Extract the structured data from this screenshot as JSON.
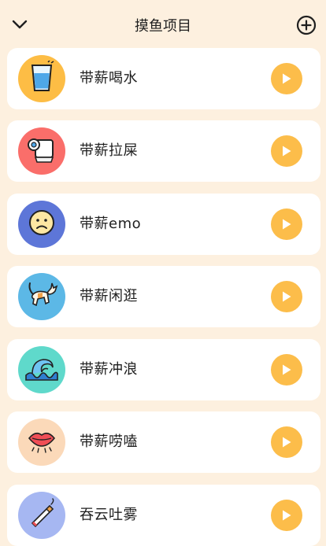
{
  "header": {
    "title": "摸鱼项目"
  },
  "items": [
    {
      "label": "带薪喝水",
      "icon": "water-glass-icon",
      "color": "#fdbd45"
    },
    {
      "label": "带薪拉屎",
      "icon": "toilet-paper-icon",
      "color": "#fa6e6a"
    },
    {
      "label": "带薪emo",
      "icon": "sad-face-icon",
      "color": "#5d76d8"
    },
    {
      "label": "带薪闲逛",
      "icon": "cat-icon",
      "color": "#5cb8e6"
    },
    {
      "label": "带薪冲浪",
      "icon": "wave-icon",
      "color": "#5fd9cb"
    },
    {
      "label": "带薪唠嗑",
      "icon": "lips-icon",
      "color": "#fbd9b9"
    },
    {
      "label": "吞云吐雾",
      "icon": "cigarette-icon",
      "color": "#a6b7f2"
    }
  ],
  "colors": {
    "background": "#fdf0df",
    "card": "#ffffff",
    "play_button": "#fcbd4a"
  }
}
